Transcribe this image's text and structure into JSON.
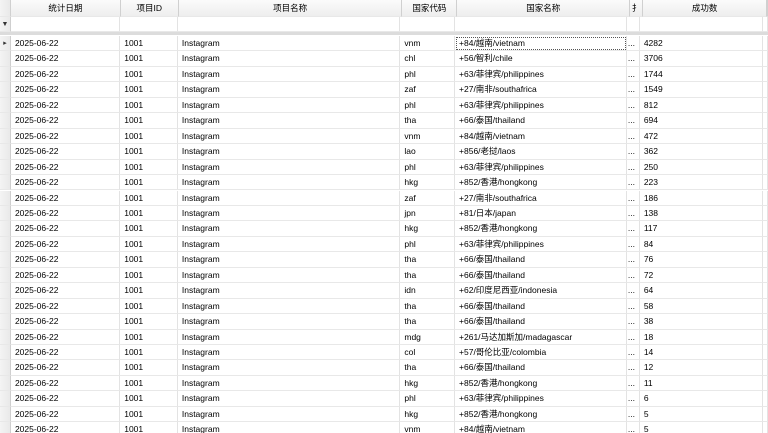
{
  "columns": {
    "date": "统计日期",
    "project_id": "项目ID",
    "project_name": "项目名称",
    "country_code": "国家代码",
    "country_name": "国家名称",
    "extra": "扌",
    "success_count": "成功数"
  },
  "indicators": {
    "filter": "▼",
    "current": "▸"
  },
  "ellipsis": "...",
  "rows": [
    {
      "date": "2025-06-22",
      "id": "1001",
      "name": "Instagram",
      "code": "vnm",
      "country": "+84/越南/vietnam",
      "count": "4282"
    },
    {
      "date": "2025-06-22",
      "id": "1001",
      "name": "Instagram",
      "code": "chl",
      "country": "+56/智利/chile",
      "count": "3706"
    },
    {
      "date": "2025-06-22",
      "id": "1001",
      "name": "Instagram",
      "code": "phl",
      "country": "+63/菲律宾/philippines",
      "count": "1744"
    },
    {
      "date": "2025-06-22",
      "id": "1001",
      "name": "Instagram",
      "code": "zaf",
      "country": "+27/南非/southafrica",
      "count": "1549"
    },
    {
      "date": "2025-06-22",
      "id": "1001",
      "name": "Instagram",
      "code": "phl",
      "country": "+63/菲律宾/philippines",
      "count": "812"
    },
    {
      "date": "2025-06-22",
      "id": "1001",
      "name": "Instagram",
      "code": "tha",
      "country": "+66/泰国/thailand",
      "count": "694"
    },
    {
      "date": "2025-06-22",
      "id": "1001",
      "name": "Instagram",
      "code": "vnm",
      "country": "+84/越南/vietnam",
      "count": "472"
    },
    {
      "date": "2025-06-22",
      "id": "1001",
      "name": "Instagram",
      "code": "lao",
      "country": "+856/老挝/laos",
      "count": "362"
    },
    {
      "date": "2025-06-22",
      "id": "1001",
      "name": "Instagram",
      "code": "phl",
      "country": "+63/菲律宾/philippines",
      "count": "250"
    },
    {
      "date": "2025-06-22",
      "id": "1001",
      "name": "Instagram",
      "code": "hkg",
      "country": "+852/香港/hongkong",
      "count": "223"
    },
    {
      "date": "2025-06-22",
      "id": "1001",
      "name": "Instagram",
      "code": "zaf",
      "country": "+27/南非/southafrica",
      "count": "186"
    },
    {
      "date": "2025-06-22",
      "id": "1001",
      "name": "Instagram",
      "code": "jpn",
      "country": "+81/日本/japan",
      "count": "138"
    },
    {
      "date": "2025-06-22",
      "id": "1001",
      "name": "Instagram",
      "code": "hkg",
      "country": "+852/香港/hongkong",
      "count": "117"
    },
    {
      "date": "2025-06-22",
      "id": "1001",
      "name": "Instagram",
      "code": "phl",
      "country": "+63/菲律宾/philippines",
      "count": "84"
    },
    {
      "date": "2025-06-22",
      "id": "1001",
      "name": "Instagram",
      "code": "tha",
      "country": "+66/泰国/thailand",
      "count": "76"
    },
    {
      "date": "2025-06-22",
      "id": "1001",
      "name": "Instagram",
      "code": "tha",
      "country": "+66/泰国/thailand",
      "count": "72"
    },
    {
      "date": "2025-06-22",
      "id": "1001",
      "name": "Instagram",
      "code": "idn",
      "country": "+62/印度尼西亚/indonesia",
      "count": "64"
    },
    {
      "date": "2025-06-22",
      "id": "1001",
      "name": "Instagram",
      "code": "tha",
      "country": "+66/泰国/thailand",
      "count": "58"
    },
    {
      "date": "2025-06-22",
      "id": "1001",
      "name": "Instagram",
      "code": "tha",
      "country": "+66/泰国/thailand",
      "count": "38"
    },
    {
      "date": "2025-06-22",
      "id": "1001",
      "name": "Instagram",
      "code": "mdg",
      "country": "+261/马达加斯加/madagascar",
      "count": "18"
    },
    {
      "date": "2025-06-22",
      "id": "1001",
      "name": "Instagram",
      "code": "col",
      "country": "+57/哥伦比亚/colombia",
      "count": "14"
    },
    {
      "date": "2025-06-22",
      "id": "1001",
      "name": "Instagram",
      "code": "tha",
      "country": "+66/泰国/thailand",
      "count": "12"
    },
    {
      "date": "2025-06-22",
      "id": "1001",
      "name": "Instagram",
      "code": "hkg",
      "country": "+852/香港/hongkong",
      "count": "11"
    },
    {
      "date": "2025-06-22",
      "id": "1001",
      "name": "Instagram",
      "code": "phl",
      "country": "+63/菲律宾/philippines",
      "count": "6"
    },
    {
      "date": "2025-06-22",
      "id": "1001",
      "name": "Instagram",
      "code": "hkg",
      "country": "+852/香港/hongkong",
      "count": "5"
    },
    {
      "date": "2025-06-22",
      "id": "1001",
      "name": "Instagram",
      "code": "vnm",
      "country": "+84/越南/vietnam",
      "count": "5"
    }
  ]
}
